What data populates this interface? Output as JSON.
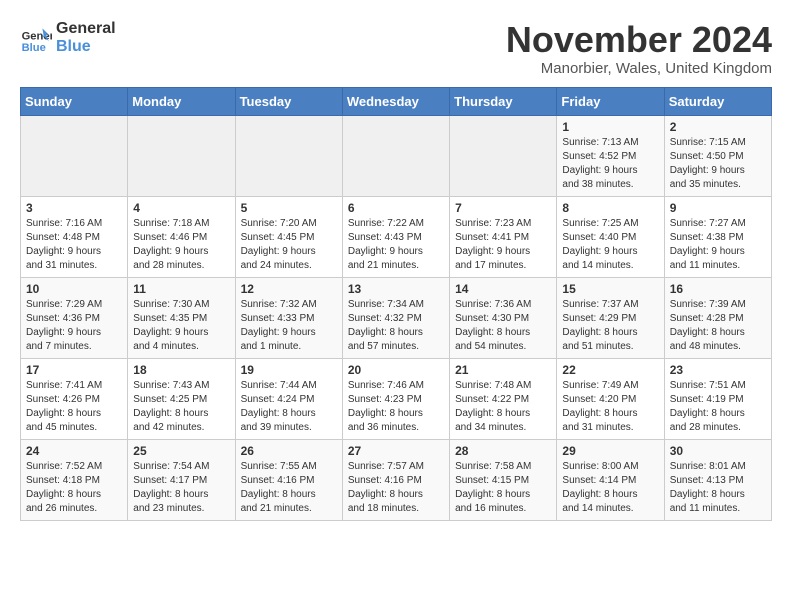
{
  "header": {
    "logo_line1": "General",
    "logo_line2": "Blue",
    "month_title": "November 2024",
    "location": "Manorbier, Wales, United Kingdom"
  },
  "weekdays": [
    "Sunday",
    "Monday",
    "Tuesday",
    "Wednesday",
    "Thursday",
    "Friday",
    "Saturday"
  ],
  "weeks": [
    [
      {
        "day": "",
        "info": ""
      },
      {
        "day": "",
        "info": ""
      },
      {
        "day": "",
        "info": ""
      },
      {
        "day": "",
        "info": ""
      },
      {
        "day": "",
        "info": ""
      },
      {
        "day": "1",
        "info": "Sunrise: 7:13 AM\nSunset: 4:52 PM\nDaylight: 9 hours\nand 38 minutes."
      },
      {
        "day": "2",
        "info": "Sunrise: 7:15 AM\nSunset: 4:50 PM\nDaylight: 9 hours\nand 35 minutes."
      }
    ],
    [
      {
        "day": "3",
        "info": "Sunrise: 7:16 AM\nSunset: 4:48 PM\nDaylight: 9 hours\nand 31 minutes."
      },
      {
        "day": "4",
        "info": "Sunrise: 7:18 AM\nSunset: 4:46 PM\nDaylight: 9 hours\nand 28 minutes."
      },
      {
        "day": "5",
        "info": "Sunrise: 7:20 AM\nSunset: 4:45 PM\nDaylight: 9 hours\nand 24 minutes."
      },
      {
        "day": "6",
        "info": "Sunrise: 7:22 AM\nSunset: 4:43 PM\nDaylight: 9 hours\nand 21 minutes."
      },
      {
        "day": "7",
        "info": "Sunrise: 7:23 AM\nSunset: 4:41 PM\nDaylight: 9 hours\nand 17 minutes."
      },
      {
        "day": "8",
        "info": "Sunrise: 7:25 AM\nSunset: 4:40 PM\nDaylight: 9 hours\nand 14 minutes."
      },
      {
        "day": "9",
        "info": "Sunrise: 7:27 AM\nSunset: 4:38 PM\nDaylight: 9 hours\nand 11 minutes."
      }
    ],
    [
      {
        "day": "10",
        "info": "Sunrise: 7:29 AM\nSunset: 4:36 PM\nDaylight: 9 hours\nand 7 minutes."
      },
      {
        "day": "11",
        "info": "Sunrise: 7:30 AM\nSunset: 4:35 PM\nDaylight: 9 hours\nand 4 minutes."
      },
      {
        "day": "12",
        "info": "Sunrise: 7:32 AM\nSunset: 4:33 PM\nDaylight: 9 hours\nand 1 minute."
      },
      {
        "day": "13",
        "info": "Sunrise: 7:34 AM\nSunset: 4:32 PM\nDaylight: 8 hours\nand 57 minutes."
      },
      {
        "day": "14",
        "info": "Sunrise: 7:36 AM\nSunset: 4:30 PM\nDaylight: 8 hours\nand 54 minutes."
      },
      {
        "day": "15",
        "info": "Sunrise: 7:37 AM\nSunset: 4:29 PM\nDaylight: 8 hours\nand 51 minutes."
      },
      {
        "day": "16",
        "info": "Sunrise: 7:39 AM\nSunset: 4:28 PM\nDaylight: 8 hours\nand 48 minutes."
      }
    ],
    [
      {
        "day": "17",
        "info": "Sunrise: 7:41 AM\nSunset: 4:26 PM\nDaylight: 8 hours\nand 45 minutes."
      },
      {
        "day": "18",
        "info": "Sunrise: 7:43 AM\nSunset: 4:25 PM\nDaylight: 8 hours\nand 42 minutes."
      },
      {
        "day": "19",
        "info": "Sunrise: 7:44 AM\nSunset: 4:24 PM\nDaylight: 8 hours\nand 39 minutes."
      },
      {
        "day": "20",
        "info": "Sunrise: 7:46 AM\nSunset: 4:23 PM\nDaylight: 8 hours\nand 36 minutes."
      },
      {
        "day": "21",
        "info": "Sunrise: 7:48 AM\nSunset: 4:22 PM\nDaylight: 8 hours\nand 34 minutes."
      },
      {
        "day": "22",
        "info": "Sunrise: 7:49 AM\nSunset: 4:20 PM\nDaylight: 8 hours\nand 31 minutes."
      },
      {
        "day": "23",
        "info": "Sunrise: 7:51 AM\nSunset: 4:19 PM\nDaylight: 8 hours\nand 28 minutes."
      }
    ],
    [
      {
        "day": "24",
        "info": "Sunrise: 7:52 AM\nSunset: 4:18 PM\nDaylight: 8 hours\nand 26 minutes."
      },
      {
        "day": "25",
        "info": "Sunrise: 7:54 AM\nSunset: 4:17 PM\nDaylight: 8 hours\nand 23 minutes."
      },
      {
        "day": "26",
        "info": "Sunrise: 7:55 AM\nSunset: 4:16 PM\nDaylight: 8 hours\nand 21 minutes."
      },
      {
        "day": "27",
        "info": "Sunrise: 7:57 AM\nSunset: 4:16 PM\nDaylight: 8 hours\nand 18 minutes."
      },
      {
        "day": "28",
        "info": "Sunrise: 7:58 AM\nSunset: 4:15 PM\nDaylight: 8 hours\nand 16 minutes."
      },
      {
        "day": "29",
        "info": "Sunrise: 8:00 AM\nSunset: 4:14 PM\nDaylight: 8 hours\nand 14 minutes."
      },
      {
        "day": "30",
        "info": "Sunrise: 8:01 AM\nSunset: 4:13 PM\nDaylight: 8 hours\nand 11 minutes."
      }
    ]
  ]
}
